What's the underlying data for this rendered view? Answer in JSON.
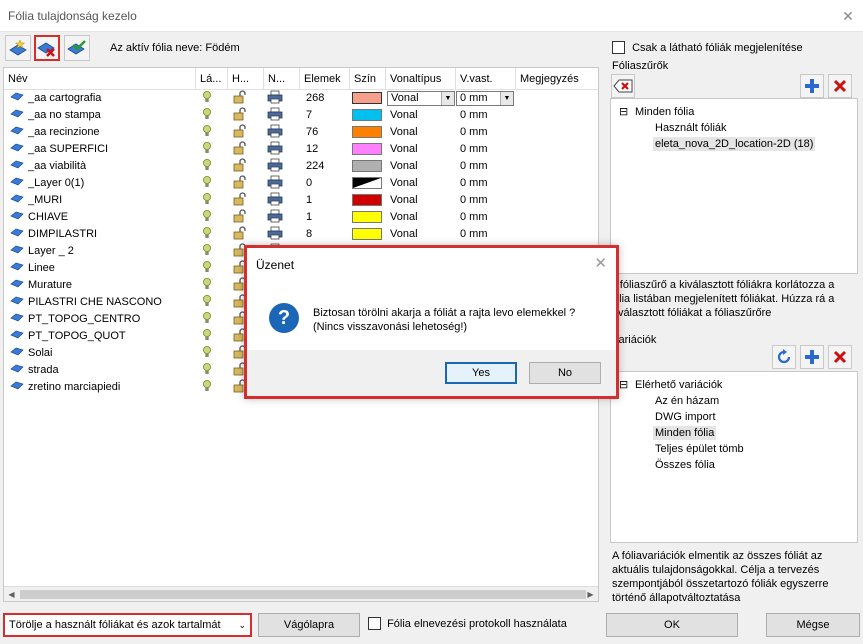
{
  "window": {
    "title": "Fólia tulajdonság kezelo",
    "close_glyph": "✕"
  },
  "toolbar": {
    "buttons": [
      {
        "name": "new-layer-button",
        "icon": "layer-add-icon"
      },
      {
        "name": "delete-layer-button",
        "icon": "layer-delete-icon",
        "active": true
      },
      {
        "name": "layer-check-button",
        "icon": "layer-check-icon"
      }
    ],
    "active_layer_label": "Az aktív fólia neve: Födém"
  },
  "table": {
    "columns": [
      "Név",
      "Lá...",
      "H...",
      "N...",
      "Elemek",
      "Szín",
      "Vonaltípus",
      "V.vast.",
      "Megjegyzés"
    ],
    "rows": [
      {
        "name": "_aa cartografia",
        "count": "268",
        "color": "#f4a08a",
        "linetype": "Vonal",
        "width": "0 mm",
        "editing": true
      },
      {
        "name": "_aa no stampa",
        "count": "7",
        "color": "#00c0f0",
        "linetype": "Vonal",
        "width": "0 mm"
      },
      {
        "name": "_aa recinzione",
        "count": "76",
        "color": "#ff8000",
        "linetype": "Vonal",
        "width": "0 mm"
      },
      {
        "name": "_aa SUPERFICI",
        "count": "12",
        "color": "#ff80ff",
        "linetype": "Vonal",
        "width": "0 mm"
      },
      {
        "name": "_aa viabilità",
        "count": "224",
        "color": "#b0b0b0",
        "linetype": "Vonal",
        "width": "0 mm"
      },
      {
        "name": "_Layer 0(1)",
        "count": "0",
        "color": "blackwhite",
        "linetype": "Vonal",
        "width": "0 mm"
      },
      {
        "name": "_MURI",
        "count": "1",
        "color": "#d00000",
        "linetype": "Vonal",
        "width": "0 mm"
      },
      {
        "name": "CHIAVE",
        "count": "1",
        "color": "#ffff00",
        "linetype": "Vonal",
        "width": "0 mm"
      },
      {
        "name": "DIMPILASTRI",
        "count": "8",
        "color": "#ffff00",
        "linetype": "Vonal",
        "width": "0 mm"
      },
      {
        "name": "Layer _ 2",
        "count": "",
        "color": "",
        "linetype": "",
        "width": ""
      },
      {
        "name": "Linee",
        "count": "",
        "color": "",
        "linetype": "",
        "width": ""
      },
      {
        "name": "Murature",
        "count": "",
        "color": "",
        "linetype": "",
        "width": ""
      },
      {
        "name": "PILASTRI CHE NASCONO",
        "count": "",
        "color": "",
        "linetype": "",
        "width": ""
      },
      {
        "name": "PT_TOPOG_CENTRO",
        "count": "",
        "color": "",
        "linetype": "",
        "width": ""
      },
      {
        "name": "PT_TOPOG_QUOT",
        "count": "",
        "color": "",
        "linetype": "",
        "width": ""
      },
      {
        "name": "Solai",
        "count": "",
        "color": "",
        "linetype": "",
        "width": ""
      },
      {
        "name": "strada",
        "count": "",
        "color": "",
        "linetype": "",
        "width": ""
      },
      {
        "name": "zretino marciapiedi",
        "count": "",
        "color": "",
        "linetype": "",
        "width": ""
      }
    ],
    "row_icons": {
      "layer": "layer-icon",
      "visible": "lightbulb-icon",
      "lock": "lock-icon",
      "print": "printer-icon"
    }
  },
  "right_panel": {
    "visible_only_label": "Csak a látható fóliák megjelenítése",
    "filters_label": "Fóliaszűrők",
    "filter_tree": {
      "root": "Minden fólia",
      "children": [
        "Használt fóliák",
        "eleta_nova_2D_location-2D (18)"
      ],
      "selected": 1
    },
    "filter_desc": [
      "A fóliaszűrő a kiválasztott fóliákra korlátozza a",
      "fólia listában megjelenített fóliákat. Húzza rá a",
      "kiválasztott fóliákat a fóliaszűrőre"
    ],
    "variations_label": "Variációk",
    "variation_tree": {
      "root": "Elérhető variációk",
      "children": [
        "Az én házam",
        "DWG import",
        "Minden fólia",
        "Teljes épület tömb",
        "Összes fólia"
      ],
      "selected": 2
    },
    "variation_desc": [
      "A fóliavariációk elmentik az összes fóliát az",
      "aktuális tulajdonságokkal. Célja a tervezés",
      "szempontjából összetartozó fóliák egyszerre",
      "történő állapotváltoztatása"
    ]
  },
  "footer": {
    "delete_select": "Törölje a használt fóliákat és azok tartalmát",
    "clipboard_button": "Vágólapra",
    "protocol_label": "Fólia elnevezési protokoll használata",
    "ok_button": "OK",
    "cancel_button": "Mégse"
  },
  "dialog": {
    "title": "Üzenet",
    "close_glyph": "✕",
    "icon": "question-icon",
    "icon_glyph": "?",
    "message_line1": "Biztosan törölni akarja a fóliát a rajta levo elemekkel ?",
    "message_line2": "(Nincs visszavonási lehetoség!)",
    "yes_button": "Yes",
    "no_button": "No"
  }
}
